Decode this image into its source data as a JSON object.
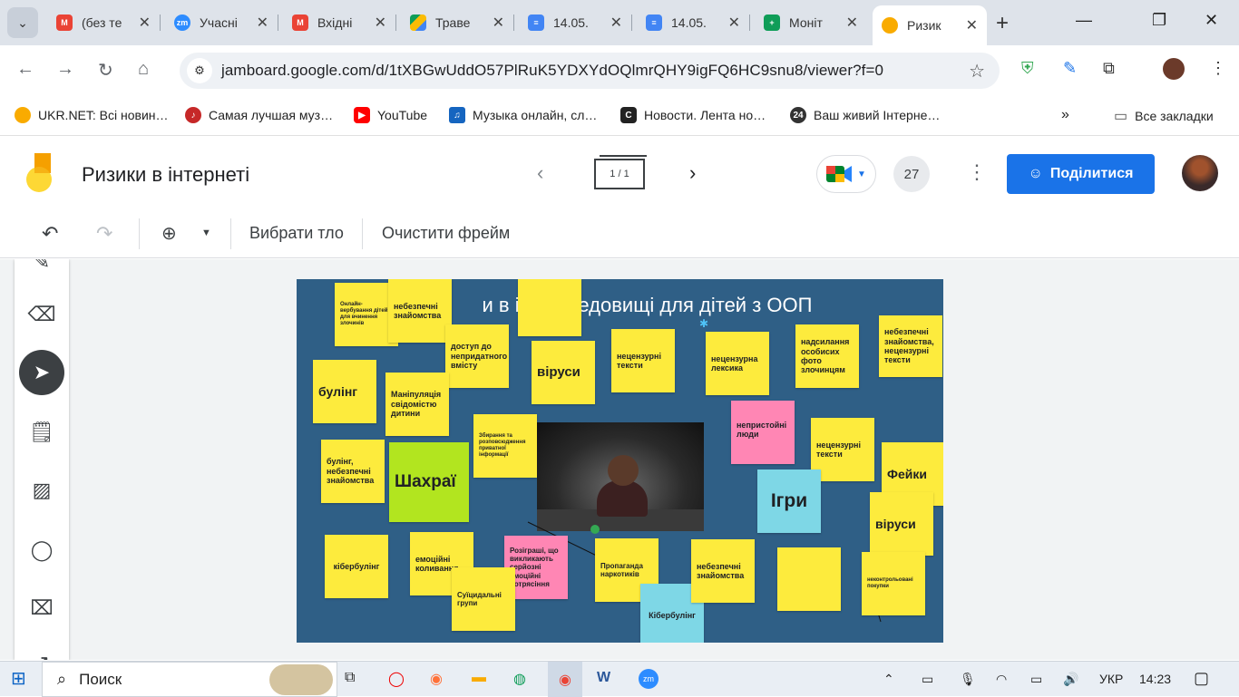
{
  "browser": {
    "tabs": [
      {
        "title": "(без те",
        "icon": "gmail-icon",
        "color": "#ea4335"
      },
      {
        "title": "Учасні",
        "icon": "zoom-icon",
        "color": "#2d8cff"
      },
      {
        "title": "Вхідні",
        "icon": "gmail-icon",
        "color": "#ea4335"
      },
      {
        "title": "Траве",
        "icon": "drive-icon",
        "color": "#fbbc04"
      },
      {
        "title": "14.05.",
        "icon": "docs-icon",
        "color": "#4285f4"
      },
      {
        "title": "14.05.",
        "icon": "docs-icon",
        "color": "#4285f4"
      },
      {
        "title": "Моніт",
        "icon": "sheets-icon",
        "color": "#0f9d58"
      },
      {
        "title": "Ризик",
        "icon": "jamboard-icon",
        "color": "#f9ab00"
      }
    ],
    "url": "jamboard.google.com/d/1tXBGwUddO57PlRuK5YDXYdOQlmrQHY9igFQ6HC9snu8/viewer?f=0",
    "bookmarks": [
      {
        "label": "UKR.NET: Всі новин…",
        "color": "#f9ab00"
      },
      {
        "label": "Самая лучшая муз…",
        "color": "#c62828"
      },
      {
        "label": "YouTube",
        "color": "#ff0000"
      },
      {
        "label": "Музыка онлайн, сл…",
        "color": "#1565c0"
      },
      {
        "label": "Новости. Лента но…",
        "color": "#222222"
      },
      {
        "label": "Ваш живий Інтерне…",
        "color": "#333333"
      }
    ],
    "all_bookmarks": "Все закладки"
  },
  "jamboard": {
    "title": "Ризики в інтернеті",
    "frame_indicator": "1 / 1",
    "viewer_count": "27",
    "share_label": "Поділитися",
    "toolbar": {
      "background_label": "Вибрати тло",
      "clear_label": "Очистити фрейм"
    },
    "board_title": "и в інте        ередовищі для дітей з ООП",
    "notes": [
      {
        "text": "Онлайн-вербування дітей для вчинення злочинів",
        "color": "yellow"
      },
      {
        "text": "небезпечні знайомства",
        "color": "yellow"
      },
      {
        "text": "",
        "color": "yellow"
      },
      {
        "text": "доступ до непридатного вмісту",
        "color": "yellow"
      },
      {
        "text": "віруси",
        "color": "yellow"
      },
      {
        "text": "нецензурні тексти",
        "color": "yellow"
      },
      {
        "text": "нецензурна лексика",
        "color": "yellow"
      },
      {
        "text": "надсилання особисих фото злочинцям",
        "color": "yellow"
      },
      {
        "text": "небезпечні знайомства, нецензурні тексти",
        "color": "yellow"
      },
      {
        "text": "булінг",
        "color": "yellow"
      },
      {
        "text": "Маніпуляція свідомістю дитини",
        "color": "yellow"
      },
      {
        "text": "Збирання та розповсюдження приватної інформації",
        "color": "yellow"
      },
      {
        "text": "непристойні люди",
        "color": "pink"
      },
      {
        "text": "нецензурні тексти",
        "color": "yellow"
      },
      {
        "text": "Фейки",
        "color": "yellow"
      },
      {
        "text": "булінг, небезпечні знайомства",
        "color": "yellow"
      },
      {
        "text": "Шахраї",
        "color": "green"
      },
      {
        "text": "Ігри",
        "color": "cyan"
      },
      {
        "text": "віруси",
        "color": "yellow"
      },
      {
        "text": "кібербулінг",
        "color": "yellow"
      },
      {
        "text": "емоційні коливання",
        "color": "yellow"
      },
      {
        "text": "Розіграші, що викликають серйозні емоційні потрясіння",
        "color": "pink"
      },
      {
        "text": "Суїцидальні групи",
        "color": "yellow"
      },
      {
        "text": "Пропаганда наркотиків",
        "color": "yellow"
      },
      {
        "text": "Кібербулінг",
        "color": "cyan"
      },
      {
        "text": "небезпечні знайомства",
        "color": "yellow"
      },
      {
        "text": "",
        "color": "yellow"
      },
      {
        "text": "неконтрольовані покупки",
        "color": "yellow"
      }
    ]
  },
  "taskbar": {
    "search_placeholder": "Поиск",
    "lang": "УКР",
    "time": "14:23"
  }
}
